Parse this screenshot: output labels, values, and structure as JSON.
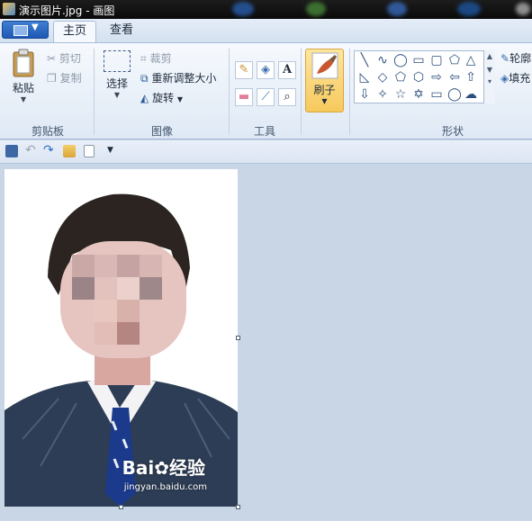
{
  "window": {
    "title": "演示图片.jpg - 画图"
  },
  "tabs": [
    {
      "label": "主页"
    },
    {
      "label": "查看"
    }
  ],
  "clipboard": {
    "paste_label": "粘贴",
    "cut_label": "剪切",
    "copy_label": "复制",
    "group_label": "剪贴板"
  },
  "image": {
    "select_label": "选择",
    "crop_label": "裁剪",
    "resize_label": "重新调整大小",
    "rotate_label": "旋转",
    "group_label": "图像"
  },
  "tools": {
    "group_label": "工具"
  },
  "brushes": {
    "label": "刷子"
  },
  "shapes": {
    "group_label": "形状",
    "outline_label": "轮廓",
    "fill_label": "填充"
  },
  "watermark": {
    "brand": "Bai",
    "brand2": "经验",
    "url": "jingyan.baidu.com"
  },
  "colors": {
    "accent": "#f7c95c",
    "ribbon": "#dfe9f5",
    "workspace": "#c9d6e6"
  }
}
